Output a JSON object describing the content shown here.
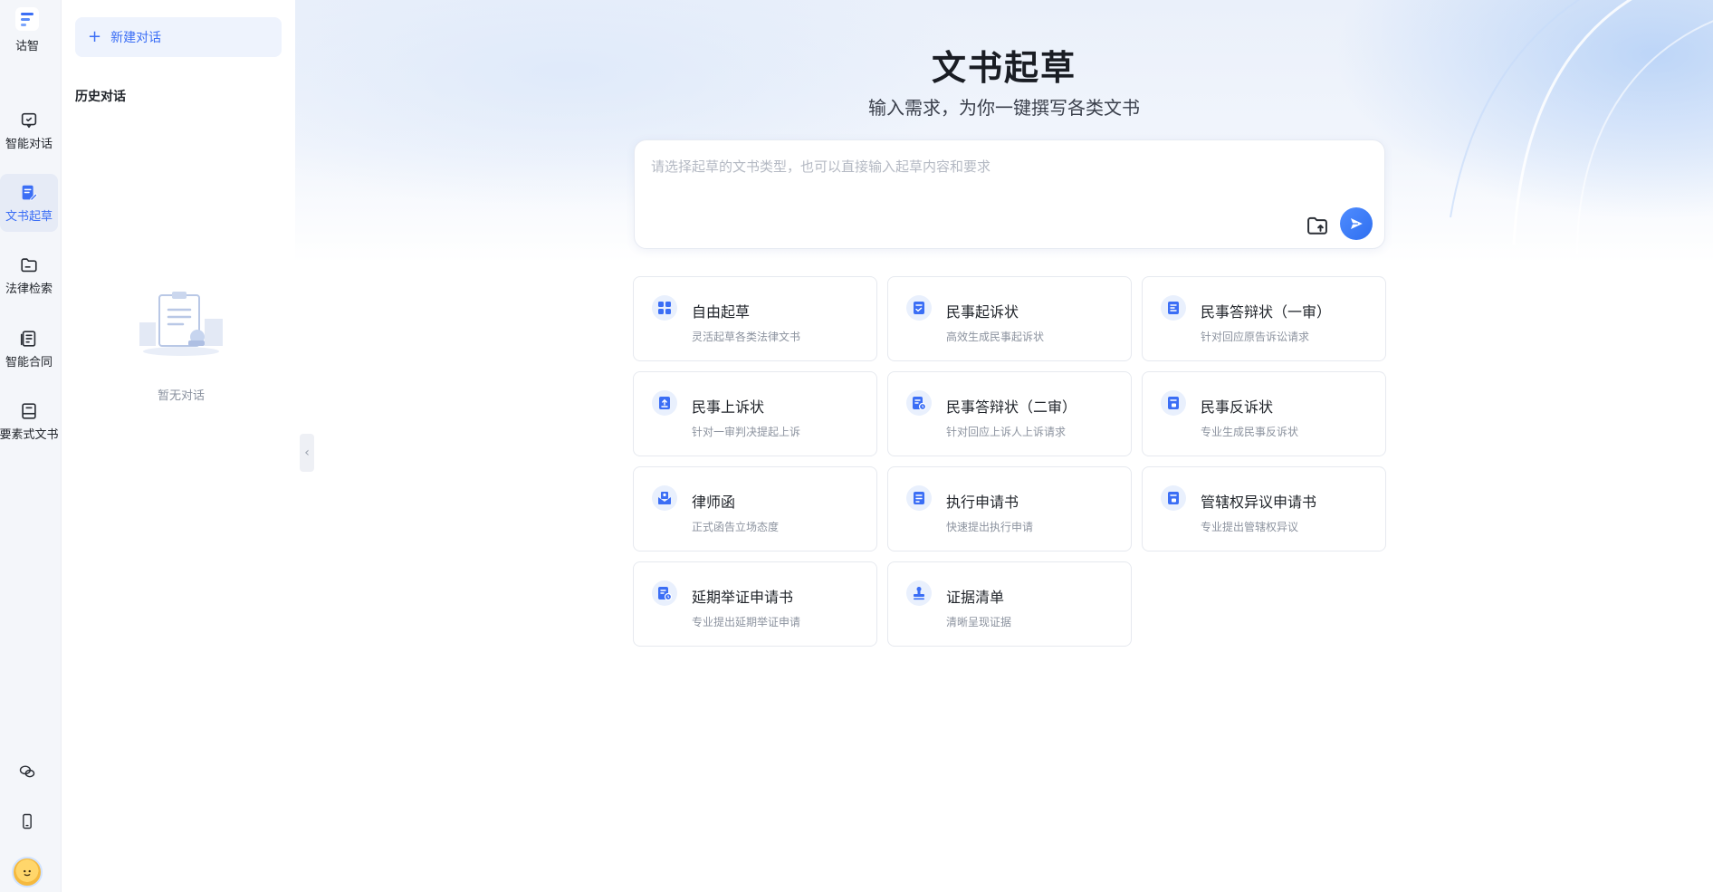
{
  "app": {
    "logo_text": "诂智"
  },
  "rail": {
    "items": [
      {
        "label": "智能对话",
        "icon": "chat-bubble-icon",
        "active": false
      },
      {
        "label": "文书起草",
        "icon": "document-edit-icon",
        "active": true
      },
      {
        "label": "法律检索",
        "icon": "folder-search-icon",
        "active": false
      },
      {
        "label": "智能合同",
        "icon": "contract-icon",
        "active": false
      },
      {
        "label": "要素式文书",
        "icon": "form-document-icon",
        "active": false
      }
    ],
    "bottom": [
      "wechat-icon",
      "mobile-icon",
      "avatar"
    ]
  },
  "history": {
    "new_chat_label": "新建对话",
    "title": "历史对话",
    "empty_text": "暂无对话"
  },
  "main": {
    "title": "文书起草",
    "subtitle": "输入需求，为你一键撰写各类文书",
    "composer": {
      "placeholder": "请选择起草的文书类型，也可以直接输入起草内容和要求",
      "value": ""
    },
    "cards": [
      {
        "title": "自由起草",
        "desc": "灵活起草各类法律文书",
        "icon": "grid-icon"
      },
      {
        "title": "民事起诉状",
        "desc": "高效生成民事起诉状",
        "icon": "document-check-icon"
      },
      {
        "title": "民事答辩状（一审）",
        "desc": "针对回应原告诉讼请求",
        "icon": "document-list-icon"
      },
      {
        "title": "民事上诉状",
        "desc": "针对一审判决提起上诉",
        "icon": "upload-document-icon"
      },
      {
        "title": "民事答辩状（二审）",
        "desc": "针对回应上诉人上诉请求",
        "icon": "document-clock-icon"
      },
      {
        "title": "民事反诉状",
        "desc": "专业生成民事反诉状",
        "icon": "document-lock-icon"
      },
      {
        "title": "律师函",
        "desc": "正式函告立场态度",
        "icon": "letter-icon"
      },
      {
        "title": "执行申请书",
        "desc": "快速提出执行申请",
        "icon": "document-lines-icon"
      },
      {
        "title": "管辖权异议申请书",
        "desc": "专业提出管辖权异议",
        "icon": "document-lock-icon"
      },
      {
        "title": "延期举证申请书",
        "desc": "专业提出延期举证申请",
        "icon": "document-clock-icon"
      },
      {
        "title": "证据清单",
        "desc": "清晰呈现证据",
        "icon": "stamp-icon"
      }
    ]
  },
  "colors": {
    "accent": "#3b6ef5",
    "rail_bg": "#f4f6fa",
    "active_bg": "#e6ebf6"
  }
}
